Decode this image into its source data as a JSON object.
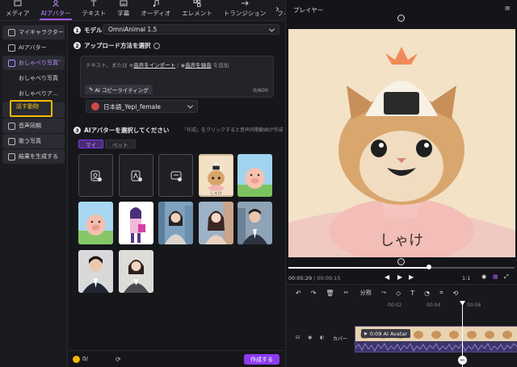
{
  "tabs": [
    {
      "label": "メディア",
      "icon": "media-icon"
    },
    {
      "label": "AIアバター",
      "icon": "avatar-icon",
      "active": true
    },
    {
      "label": "テキスト",
      "icon": "text-icon"
    },
    {
      "label": "字幕",
      "icon": "subtitle-icon"
    },
    {
      "label": "オーディオ",
      "icon": "audio-icon"
    },
    {
      "label": "エレメント",
      "icon": "element-icon"
    },
    {
      "label": "トランジション",
      "icon": "transition-icon"
    },
    {
      "label": "フィルター",
      "icon": "filter-icon"
    }
  ],
  "sidebar": {
    "items": [
      {
        "label": "マイキャラクター"
      },
      {
        "label": "AIアバター"
      },
      {
        "label": "おしゃべり写真"
      },
      {
        "label": "おしゃべり写真"
      },
      {
        "label": "おしゃべりア..."
      },
      {
        "label": "話す動物"
      },
      {
        "label": "音声同期"
      },
      {
        "label": "歌う写真"
      },
      {
        "label": "結果を生成する"
      }
    ]
  },
  "model": {
    "step": "1",
    "label": "モデル",
    "value": "OmniAnimal 1.5"
  },
  "upload": {
    "step": "2",
    "label": "アップロード方法を選択",
    "placeholder_pre": "テキスト、または",
    "import_link": "音声をインポート",
    "sep": " / ",
    "record_link": "音声を録音",
    "placeholder_post": " を追加",
    "copy_button": "AI コピーライティング",
    "count": "0/600",
    "voice": "日本語_Yepi_female"
  },
  "avatar": {
    "step": "3",
    "label": "AIアバターを選択してください",
    "hint": "「作成」をクリックすると音声同期動画が作成でき…",
    "tab_my": "マイ",
    "tab_pet": "ペット",
    "cat_caption": "しゃけ"
  },
  "footer": {
    "credit": "0/",
    "create_button": "作成する"
  },
  "player": {
    "title": "プレイヤー",
    "caption": "しゃけ",
    "current_time": "00:05:29",
    "total_time": "/ 00:09:15",
    "speed": "1:1",
    "progress": 0.62
  },
  "timeline": {
    "split": "分割",
    "ruler": [
      "00:02",
      "00:04",
      "00:06"
    ],
    "clip_label": "0:09 AI Avatar",
    "cover": "カバー"
  }
}
